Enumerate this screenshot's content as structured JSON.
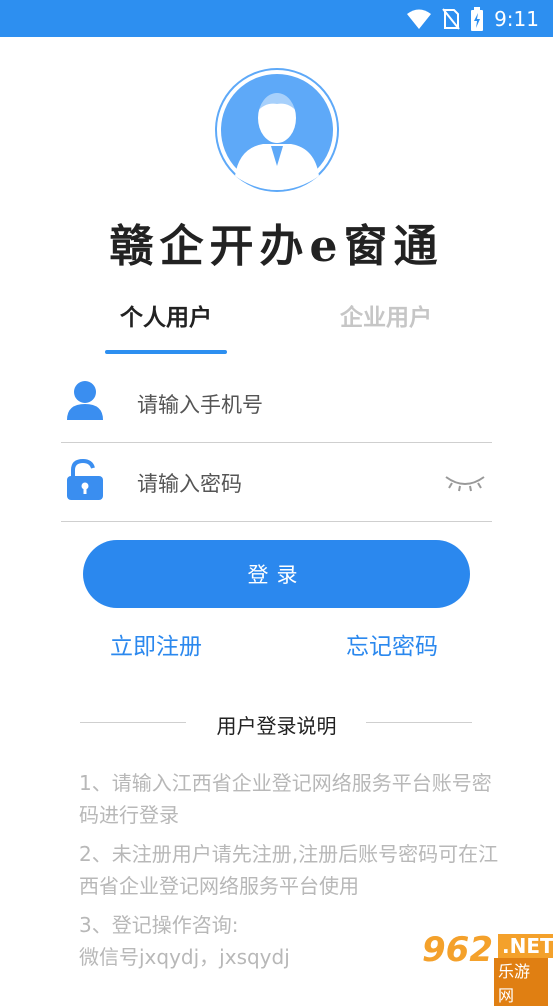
{
  "status_bar": {
    "time": "9:11"
  },
  "app": {
    "title": "赣企开办e窗通"
  },
  "tabs": [
    {
      "label": "个人用户",
      "active": true
    },
    {
      "label": "企业用户",
      "active": false
    }
  ],
  "form": {
    "phone_placeholder": "请输入手机号",
    "password_placeholder": "请输入密码",
    "login_label": "登录"
  },
  "links": {
    "register": "立即注册",
    "forgot": "忘记密码"
  },
  "notes": {
    "title": "用户登录说明",
    "items": [
      "1、请输入江西省企业登记网络服务平台账号密码进行登录",
      "2、未注册用户请先注册,注册后账号密码可在江西省企业登记网络服务平台使用",
      "3、登记操作咨询:",
      "微信号jxqydj，jxsqydj"
    ]
  },
  "watermark": {
    "number": "962",
    "net": ".NET",
    "site": "乐游网"
  },
  "colors": {
    "primary": "#2b88ee",
    "status_bar": "#2d8ff0",
    "avatar": "#5ea9f8"
  }
}
